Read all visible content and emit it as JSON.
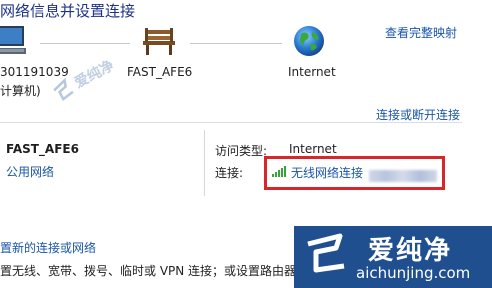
{
  "header": {
    "title": "网络信息并设置连接",
    "full_map_link": "查看完整映射"
  },
  "map": {
    "computer_name": "301191039",
    "computer_sublabel": "计算机)",
    "router_name": "FAST_AFE6",
    "internet_label": "Internet"
  },
  "connect_disconnect_link": "连接或断开连接",
  "network": {
    "name": "FAST_AFE6",
    "type": "公用网络",
    "access_type_label": "访问类型:",
    "access_type_value": "Internet",
    "connection_label": "连接:",
    "connection_value": "无线网络连接"
  },
  "bottom": {
    "new_connection_link": "置新的连接或网络",
    "description": "置无线、宽带、拨号、临时或 VPN 连接；或设置路由器"
  },
  "watermarks": {
    "center_text": "爱纯净",
    "brand_cn": "爱纯净",
    "brand_url": "aichunjing.com"
  },
  "colors": {
    "link": "#1a56a8",
    "title": "#1e3287",
    "highlight_box": "#d8262b",
    "watermark_bg": "#1f4f8f"
  },
  "icons": {
    "computer": "computer-icon",
    "router": "bench-router-icon",
    "internet": "globe-icon",
    "signal": "wifi-signal-icon"
  }
}
